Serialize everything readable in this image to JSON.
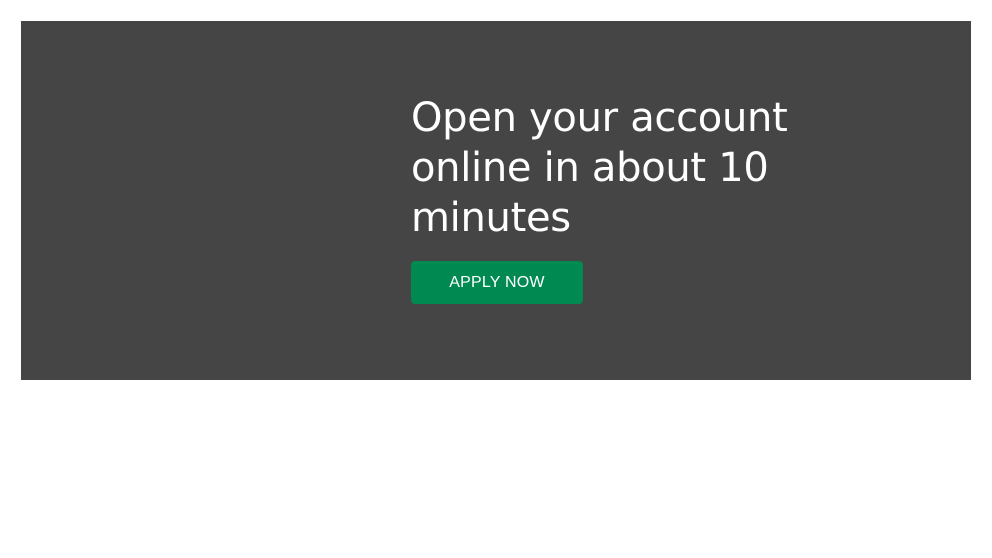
{
  "banner": {
    "headline": "Open your account online in about 10 minutes",
    "cta_label": "APPLY NOW",
    "background_color": "#454545",
    "cta_color": "#008a52"
  }
}
